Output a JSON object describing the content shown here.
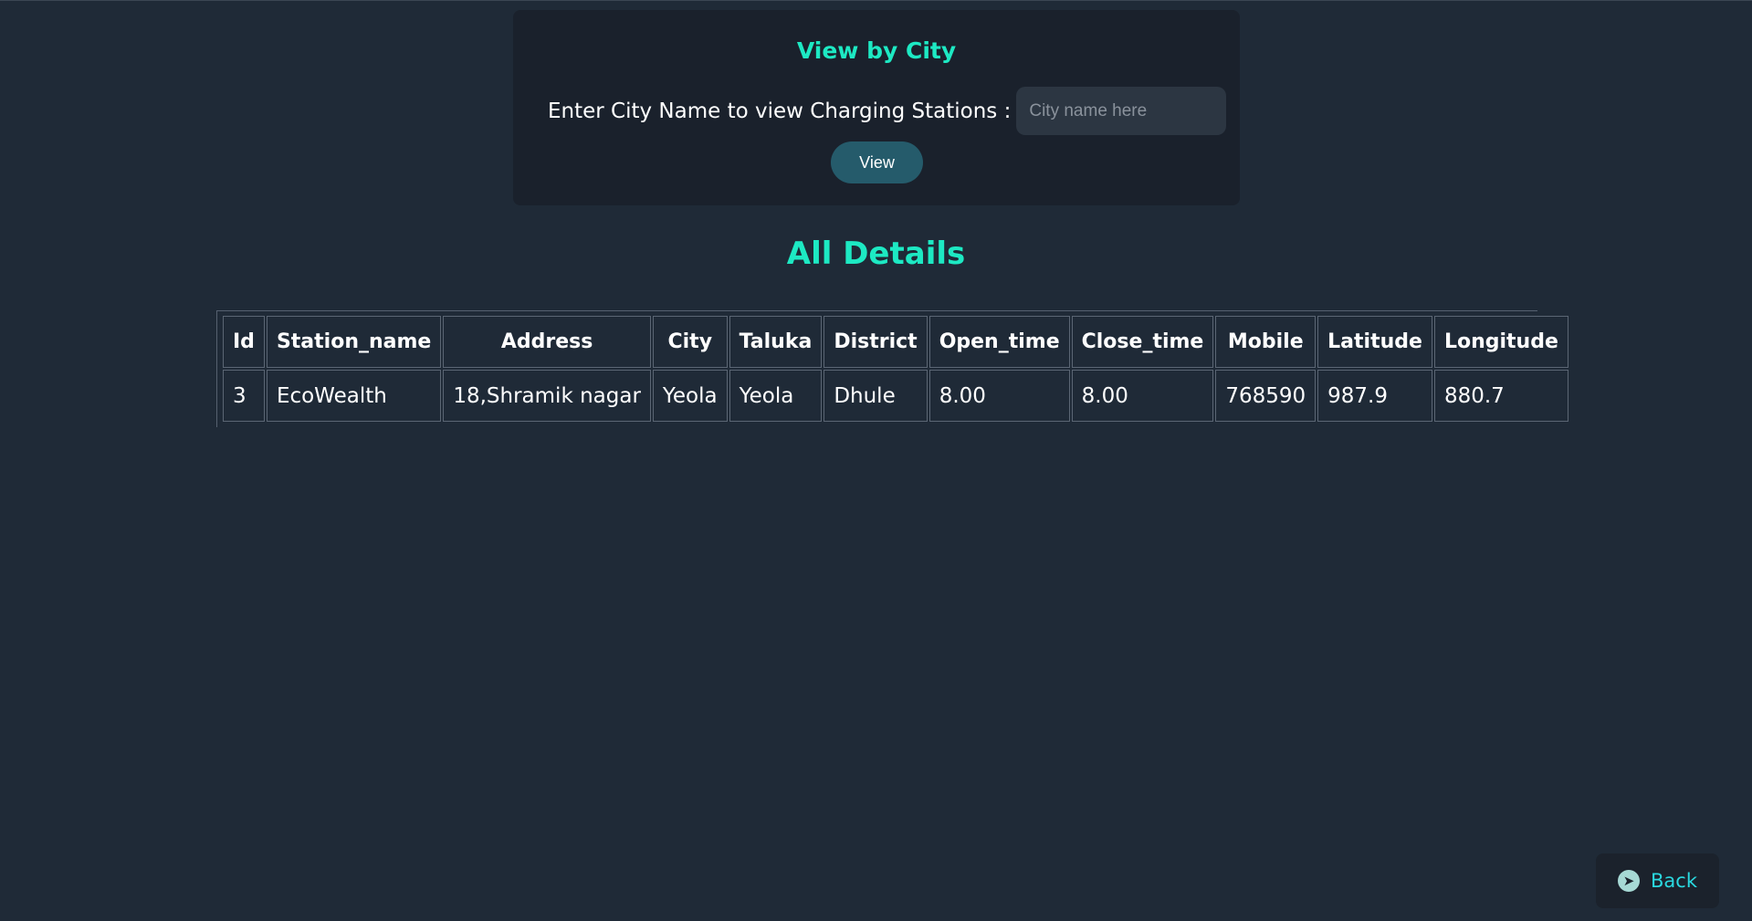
{
  "search_panel": {
    "title": "View by City",
    "label": "Enter City Name to view Charging Stations :",
    "input_placeholder": "City name here",
    "input_value": "",
    "button_label": "View"
  },
  "section_title": "All Details",
  "table": {
    "headers": [
      "Id",
      "Station_name",
      "Address",
      "City",
      "Taluka",
      "District",
      "Open_time",
      "Close_time",
      "Mobile",
      "Latitude",
      "Longitude"
    ],
    "rows": [
      [
        "3",
        "EcoWealth",
        "18,Shramik nagar",
        "Yeola",
        "Yeola",
        "Dhule",
        "8.00",
        "8.00",
        "768590",
        "987.9",
        "880.7"
      ]
    ]
  },
  "back_button": {
    "label": "Back",
    "icon": "back-arrow-icon"
  },
  "colors": {
    "background": "#1f2a37",
    "panel": "#1a212c",
    "accent": "#1de9c3",
    "button": "#255b6b",
    "back_text": "#2ad9e0"
  }
}
